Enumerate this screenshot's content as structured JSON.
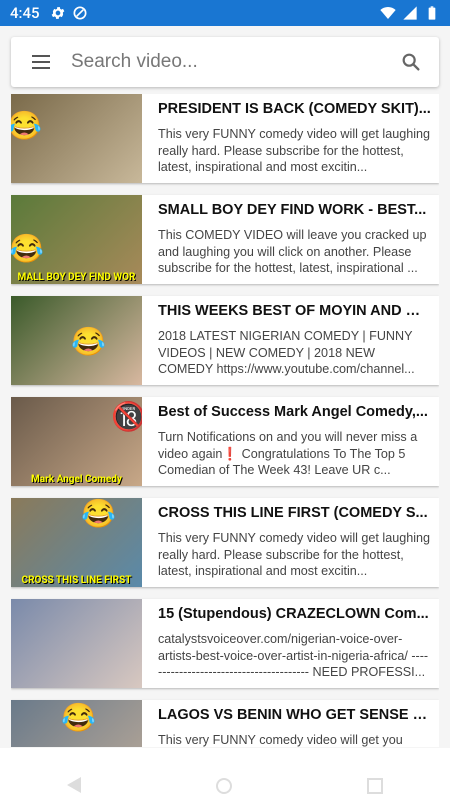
{
  "status_bar": {
    "time": "4:45",
    "left_icons": [
      "gear-icon",
      "no-sync-icon"
    ],
    "right_icons": [
      "wifi-icon",
      "signal-icon",
      "battery-icon"
    ]
  },
  "search": {
    "placeholder": "Search video...",
    "value": ""
  },
  "videos": [
    {
      "title": "PRESIDENT IS BACK (COMEDY SKIT)...",
      "description": "This very FUNNY comedy video will get laughing really hard. Please subscribe for the hottest, latest, inspirational and most excitin...",
      "thumb_caption": "",
      "thumb_colors": [
        "#7a6a4a",
        "#c8b89a"
      ]
    },
    {
      "title": "SMALL BOY DEY FIND WORK - BEST...",
      "description": "This COMEDY VIDEO will leave you cracked up and laughing you will click on another. Please subscribe for the hottest, latest, inspirational ...",
      "thumb_caption": "MALL BOY DEY FIND WOR",
      "thumb_colors": [
        "#5a7a3a",
        "#a88a5a"
      ]
    },
    {
      "title": "THIS WEEKS BEST OF MOYIN AND GL...",
      "description": "2018 LATEST NIGERIAN COMEDY | FUNNY VIDEOS | NEW COMEDY | 2018 NEW COMEDY https://www.youtube.com/channel...",
      "thumb_caption": "",
      "thumb_colors": [
        "#3a5a2a",
        "#d8b8a0"
      ]
    },
    {
      "title": "Best of Success Mark Angel Comedy,...",
      "description": "Turn Notifications on and you will never miss a video again❗ Congratulations To The Top 5 Comedian of The Week 43! Leave UR c...",
      "thumb_caption": "Mark Angel Comedy",
      "thumb_colors": [
        "#6a5a4a",
        "#c8a888"
      ]
    },
    {
      "title": "CROSS THIS LINE FIRST (COMEDY S...",
      "description": "This very FUNNY comedy video will get laughing really hard. Please subscribe for the hottest, latest, inspirational and most excitin...",
      "thumb_caption": "CROSS THIS LINE FIRST",
      "thumb_colors": [
        "#8a7a5a",
        "#5a8aaa"
      ]
    },
    {
      "title": "15 (Stupendous) CRAZECLOWN Com...",
      "description": "catalystsvoiceover.com/nigerian-voice-over-artists-best-voice-over-artist-in-nigeria-africa/ ---------------------------------------- NEED PROFESSI...",
      "thumb_caption": "",
      "thumb_colors": [
        "#7a8aaa",
        "#d8c8c0"
      ]
    },
    {
      "title": "LAGOS VS BENIN WHO GET SENSE P...",
      "description": "This very FUNNY comedy video will get you",
      "thumb_caption": "",
      "thumb_colors": [
        "#6a7a8a",
        "#b8a898"
      ]
    }
  ]
}
